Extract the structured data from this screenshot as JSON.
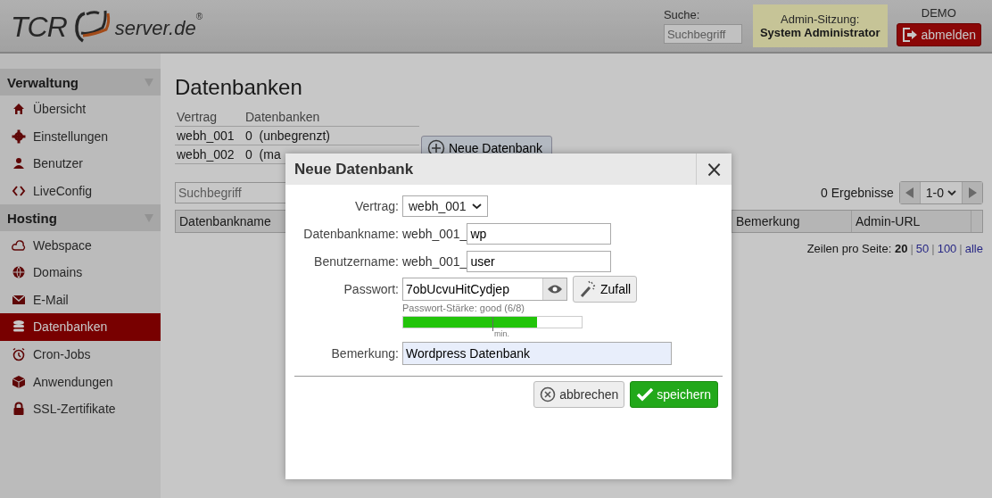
{
  "header": {
    "logo": {
      "left": "TCR",
      "right": "server.de",
      "mark": "®"
    },
    "search": {
      "label": "Suche:",
      "placeholder": "Suchbegriff"
    },
    "session": {
      "label": "Admin-Sitzung:",
      "user": "System Administrator"
    },
    "mode": "DEMO",
    "logout": "abmelden"
  },
  "sidebar": [
    {
      "title": "Verwaltung",
      "expanded": true,
      "items": [
        {
          "label": "Übersicht",
          "selected": false
        },
        {
          "label": "Einstellungen",
          "selected": false
        },
        {
          "label": "Benutzer",
          "selected": false
        },
        {
          "label": "LiveConfig",
          "selected": false
        }
      ]
    },
    {
      "title": "Hosting",
      "expanded": true,
      "items": [
        {
          "label": "Webspace",
          "selected": false
        },
        {
          "label": "Domains",
          "selected": false
        },
        {
          "label": "E-Mail",
          "selected": false
        },
        {
          "label": "Datenbanken",
          "selected": true
        },
        {
          "label": "Cron-Jobs",
          "selected": false
        },
        {
          "label": "Anwendungen",
          "selected": false
        },
        {
          "label": "SSL-Zertifikate",
          "selected": false
        }
      ]
    }
  ],
  "page": {
    "title": "Datenbanken",
    "contracts": {
      "columns": [
        "Vertrag",
        "Datenbanken"
      ],
      "rows": [
        [
          "webh_001",
          "0",
          "(unbegrenzt)"
        ],
        [
          "webh_002",
          "0",
          "(ma"
        ]
      ]
    },
    "new_button": "Neue Datenbank",
    "search": {
      "placeholder": "Suchbegriff"
    },
    "results": "0 Ergebnisse",
    "page_select": "1-0",
    "table": {
      "columns": [
        "Datenbankname",
        "Bemerkung",
        "Admin-URL"
      ]
    },
    "rows_per_page": {
      "label": "Zeilen pro Seite:",
      "separator": "|",
      "options": [
        {
          "label": "20",
          "selected": true
        },
        {
          "label": "50",
          "selected": false
        },
        {
          "label": "100",
          "selected": false
        },
        {
          "label": "alle",
          "selected": false
        }
      ]
    }
  },
  "dialog": {
    "title": "Neue Datenbank",
    "close": "×",
    "fields": [
      {
        "kind": "select",
        "label": "Vertrag:",
        "value": "webh_001"
      },
      {
        "kind": "prefixed",
        "label": "Datenbankname:",
        "prefix": "webh_001_",
        "value": "wp"
      },
      {
        "kind": "prefixed",
        "label": "Benutzername:",
        "prefix": "webh_001_",
        "value": "user"
      },
      {
        "kind": "password",
        "label": "Passwort:",
        "value": "7obUcvuHitCydjep",
        "button": "Zufall",
        "strength_label": "Passwort-Stärke: good (6/8)",
        "level": 0.75,
        "min_label": "min."
      },
      {
        "kind": "text",
        "label": "Bemerkung:",
        "value": "Wordpress Datenbank",
        "focused": true
      }
    ],
    "buttons": [
      {
        "kind": "cancel",
        "label": "abbrechen"
      },
      {
        "kind": "save",
        "label": "speichern"
      }
    ]
  }
}
